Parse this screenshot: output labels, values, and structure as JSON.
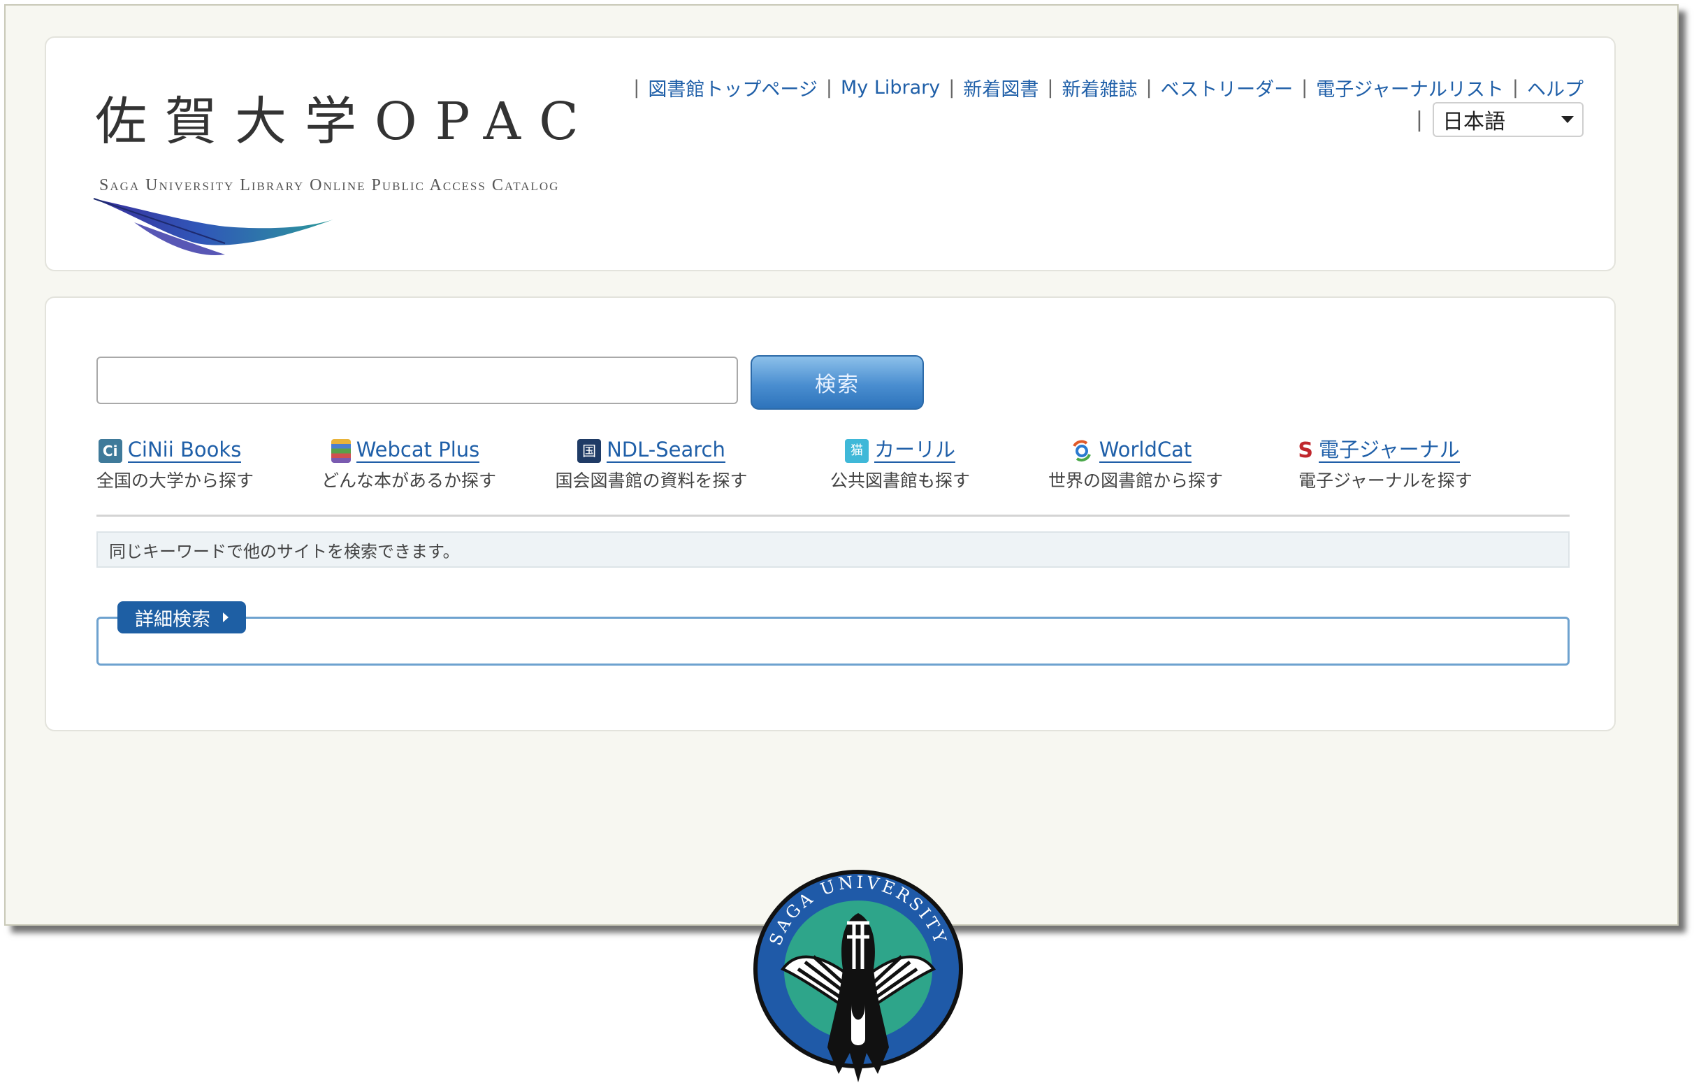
{
  "logo": {
    "title": "佐賀大学OPAC",
    "subtitle": "Saga University Library Online Public Access Catalog"
  },
  "topnav": {
    "items": [
      {
        "label": "図書館トップページ"
      },
      {
        "label": "My Library"
      },
      {
        "label": "新着図書"
      },
      {
        "label": "新着雑誌"
      },
      {
        "label": "ベストリーダー"
      },
      {
        "label": "電子ジャーナルリスト"
      },
      {
        "label": "ヘルプ"
      }
    ],
    "language": "日本語"
  },
  "search": {
    "input_value": "",
    "button_label": "検索"
  },
  "sources": [
    {
      "name": "CiNii Books",
      "desc": "全国の大学から探す",
      "icon": "cinii-icon",
      "icon_text": "Ci"
    },
    {
      "name": "Webcat Plus",
      "desc": "どんな本があるか探す",
      "icon": "books-stack-icon",
      "icon_text": ""
    },
    {
      "name": "NDL-Search",
      "desc": "国会図書館の資料を探す",
      "icon": "ndl-icon",
      "icon_text": "国"
    },
    {
      "name": "カーリル",
      "desc": "公共図書館も探す",
      "icon": "calil-cat-icon",
      "icon_text": "猫"
    },
    {
      "name": "WorldCat",
      "desc": "世界の図書館から探す",
      "icon": "worldcat-icon",
      "icon_text": ""
    },
    {
      "name": "電子ジャーナル",
      "desc": "電子ジャーナルを探す",
      "icon": "ejournal-icon",
      "icon_text": "S"
    }
  ],
  "notice": "同じキーワードで他のサイトを検索できます。",
  "advanced_search": {
    "label": "詳細検索"
  },
  "emblem": {
    "text": "SAGA UNIVERSITY"
  },
  "colors": {
    "link": "#1f5fa8",
    "button": "#4a8ed0",
    "tab": "#1e5fa4",
    "background": "#f7f7f1"
  }
}
